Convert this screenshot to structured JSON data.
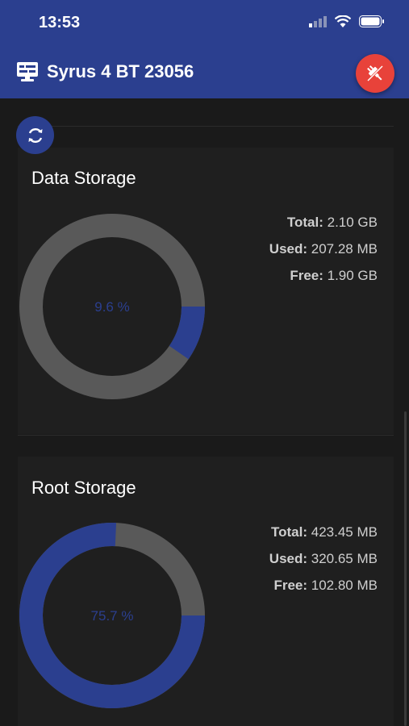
{
  "status_bar": {
    "time": "13:53"
  },
  "app_bar": {
    "title": "Syrus 4 BT 23056"
  },
  "data_storage": {
    "title": "Data Storage",
    "percent_label": "9.6 %",
    "used_fraction": 0.096,
    "total_label": "Total:",
    "total_value": "2.10 GB",
    "used_label": "Used:",
    "used_value": "207.28 MB",
    "free_label": "Free:",
    "free_value": "1.90 GB"
  },
  "root_storage": {
    "title": "Root Storage",
    "percent_label": "75.7 %",
    "used_fraction": 0.757,
    "total_label": "Total:",
    "total_value": "423.45 MB",
    "used_label": "Used:",
    "used_value": "320.65 MB",
    "free_label": "Free:",
    "free_value": "102.80 MB"
  },
  "colors": {
    "accent": "#2b3f8f",
    "danger": "#e8423a",
    "ring_track": "#595959",
    "background": "#1a1a1a"
  },
  "icons": {
    "device": "monitor-icon",
    "disconnect": "plug-icon",
    "refresh": "refresh-icon"
  }
}
